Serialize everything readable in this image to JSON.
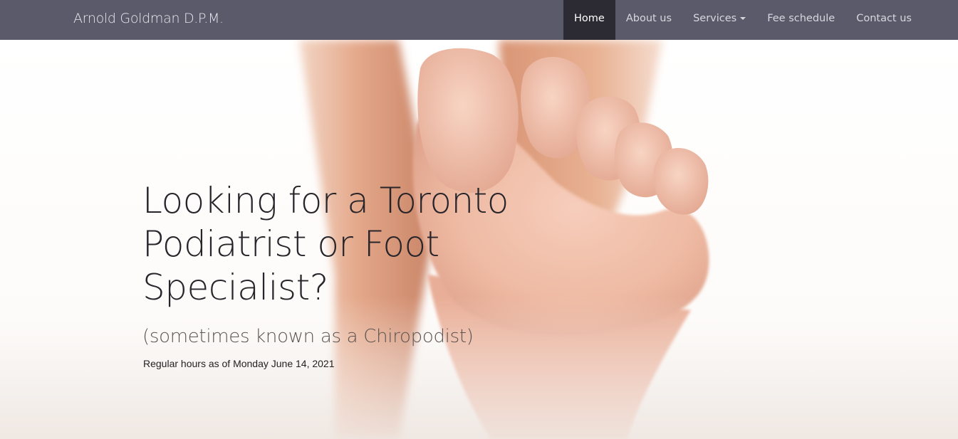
{
  "navbar": {
    "brand": "Arnold Goldman D.P.M.",
    "items": [
      {
        "label": "Home",
        "active": true
      },
      {
        "label": "About us",
        "active": false
      },
      {
        "label": "Services",
        "active": false,
        "dropdown": true
      },
      {
        "label": "Fee schedule",
        "active": false
      },
      {
        "label": "Contact us",
        "active": false
      }
    ],
    "colors": {
      "background": "#5b5a6a",
      "active_background": "#2c2b34"
    }
  },
  "hero": {
    "image": "bare-foot-photo",
    "headline": "Looking for a Toronto Podiatrist or Foot Specialist?",
    "subheadline": "(sometimes known as a Chiropodist)",
    "hours_note": "Regular hours as of Monday June 14, 2021"
  }
}
